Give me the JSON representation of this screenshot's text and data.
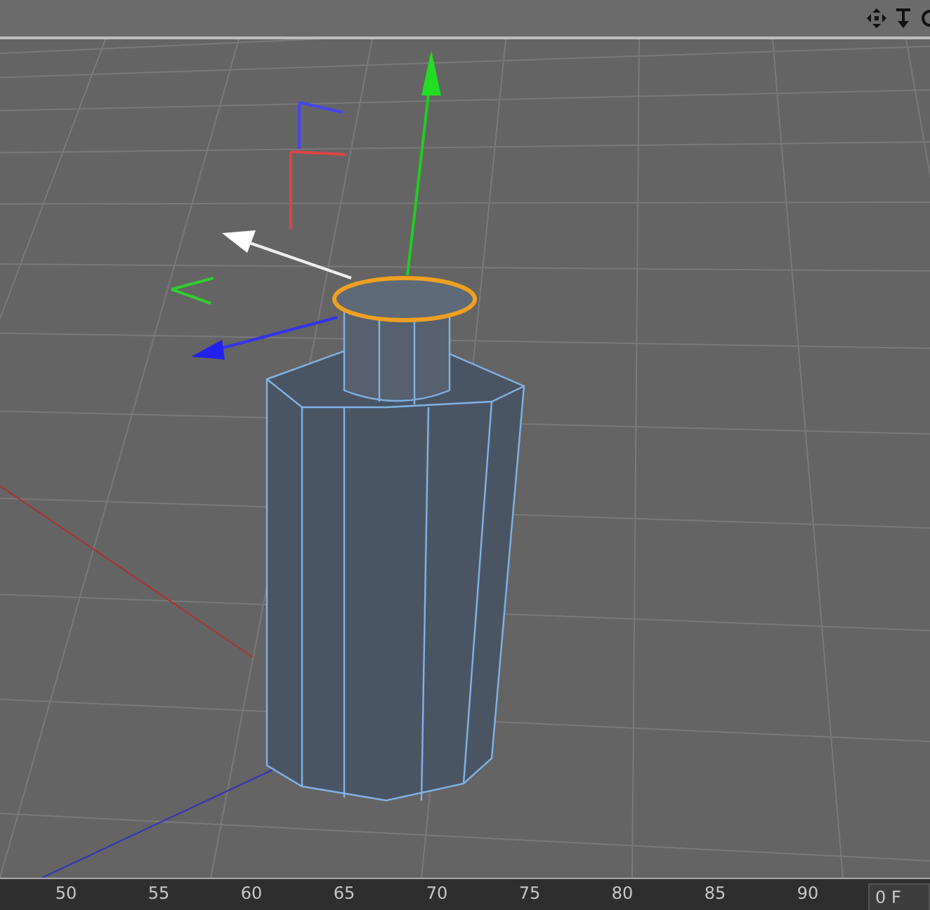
{
  "timeline": {
    "ticks": [
      "50",
      "55",
      "60",
      "65",
      "70",
      "75",
      "80",
      "85",
      "90"
    ],
    "frame_field": "0 F"
  }
}
